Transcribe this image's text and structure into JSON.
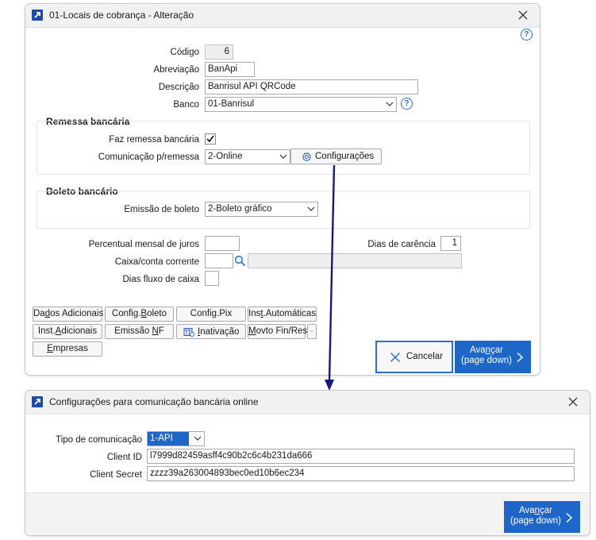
{
  "colors": {
    "accent": "#1e66c7",
    "arrow": "#1a1a7a",
    "titlebar_bg": "#f1f1f1"
  },
  "win1": {
    "title": "01-Locais de cobrança - Alteração",
    "icons": {
      "app": "arrow-up-right-icon",
      "close": "close-icon",
      "help": "help-icon"
    },
    "fields": {
      "codigo_label": "Código",
      "codigo_value": "6",
      "abrev_label": "Abreviação",
      "abrev_value": "BanApi",
      "descricao_label": "Descrição",
      "descricao_value": "Banrisul API QRCode",
      "banco_label": "Banco",
      "banco_value": "01-Banrisul"
    },
    "remessa": {
      "title": "Remessa bancária",
      "faz_label": "Faz remessa bancária",
      "faz_checked": true,
      "com_label": "Comunicação p/remessa",
      "com_value": "2-Online",
      "config_button": "Configurações"
    },
    "boleto": {
      "title": "Boleto bancário",
      "emissao_label": "Emissão de boleto",
      "emissao_value": "2-Boleto gráfico"
    },
    "extra": {
      "juros_label": "Percentual mensal de juros",
      "juros_value": "",
      "carencia_label": "Dias de carência",
      "carencia_value": "1",
      "caixa_label": "Caixa/conta corrente",
      "caixa_value": "",
      "caixa_desc": "",
      "fluxo_label": "Dias fluxo de caixa",
      "fluxo_value": ""
    },
    "buttons": {
      "dados_pre": "Da",
      "dados_u": "d",
      "dados_post": "os Adicionais",
      "configboleto_pre": "Config.",
      "configboleto_u": "B",
      "configboleto_post": "oleto",
      "configpix": "Config.Pix",
      "instauto_pre": "Ins",
      "instauto_u": "t",
      "instauto_post": ".Automáticas",
      "instadic_pre": "Inst.",
      "instadic_u": "A",
      "instadic_post": "dicionais",
      "emissaonf_pre": "Emissão ",
      "emissaonf_u": "N",
      "emissaonf_post": "F",
      "inativacao_u": "I",
      "inativacao_post": "nativação",
      "movto_pre": "",
      "movto_u": "M",
      "movto_post": "ovto Fin/Res",
      "more": "-",
      "empresas_pre": "",
      "empresas_u": "E",
      "empresas_post": "mpresas",
      "cancelar": "Cancelar",
      "avancar_pre": "Ava",
      "avancar_u": "n",
      "avancar_post": "çar",
      "avancar_sub": "(page down)"
    }
  },
  "win2": {
    "title": "Configurações para comunicação bancária online",
    "tipo_label": "Tipo de comunicação",
    "tipo_value": "1-API",
    "client_id_label": "Client ID",
    "client_id_value": "l7999d82459asff4c90b2c6c4b231da666",
    "client_secret_label": "Client Secret",
    "client_secret_value": "zzzz39a263004893bec0ed10b6ec234",
    "avancar_pre": "Ava",
    "avancar_u": "n",
    "avancar_post": "çar",
    "avancar_sub": "(page down)"
  }
}
